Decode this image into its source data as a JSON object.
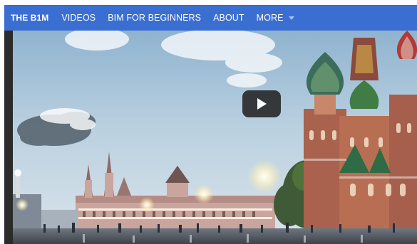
{
  "navbar": {
    "brand": "THE B1M",
    "items": [
      {
        "label": "VIDEOS"
      },
      {
        "label": "BIM FOR BEGINNERS"
      },
      {
        "label": "ABOUT"
      },
      {
        "label": "MORE"
      }
    ],
    "more_icon": "chevron-down-icon",
    "background": "#3b6ed1"
  },
  "video": {
    "play_icon": "play-icon"
  }
}
